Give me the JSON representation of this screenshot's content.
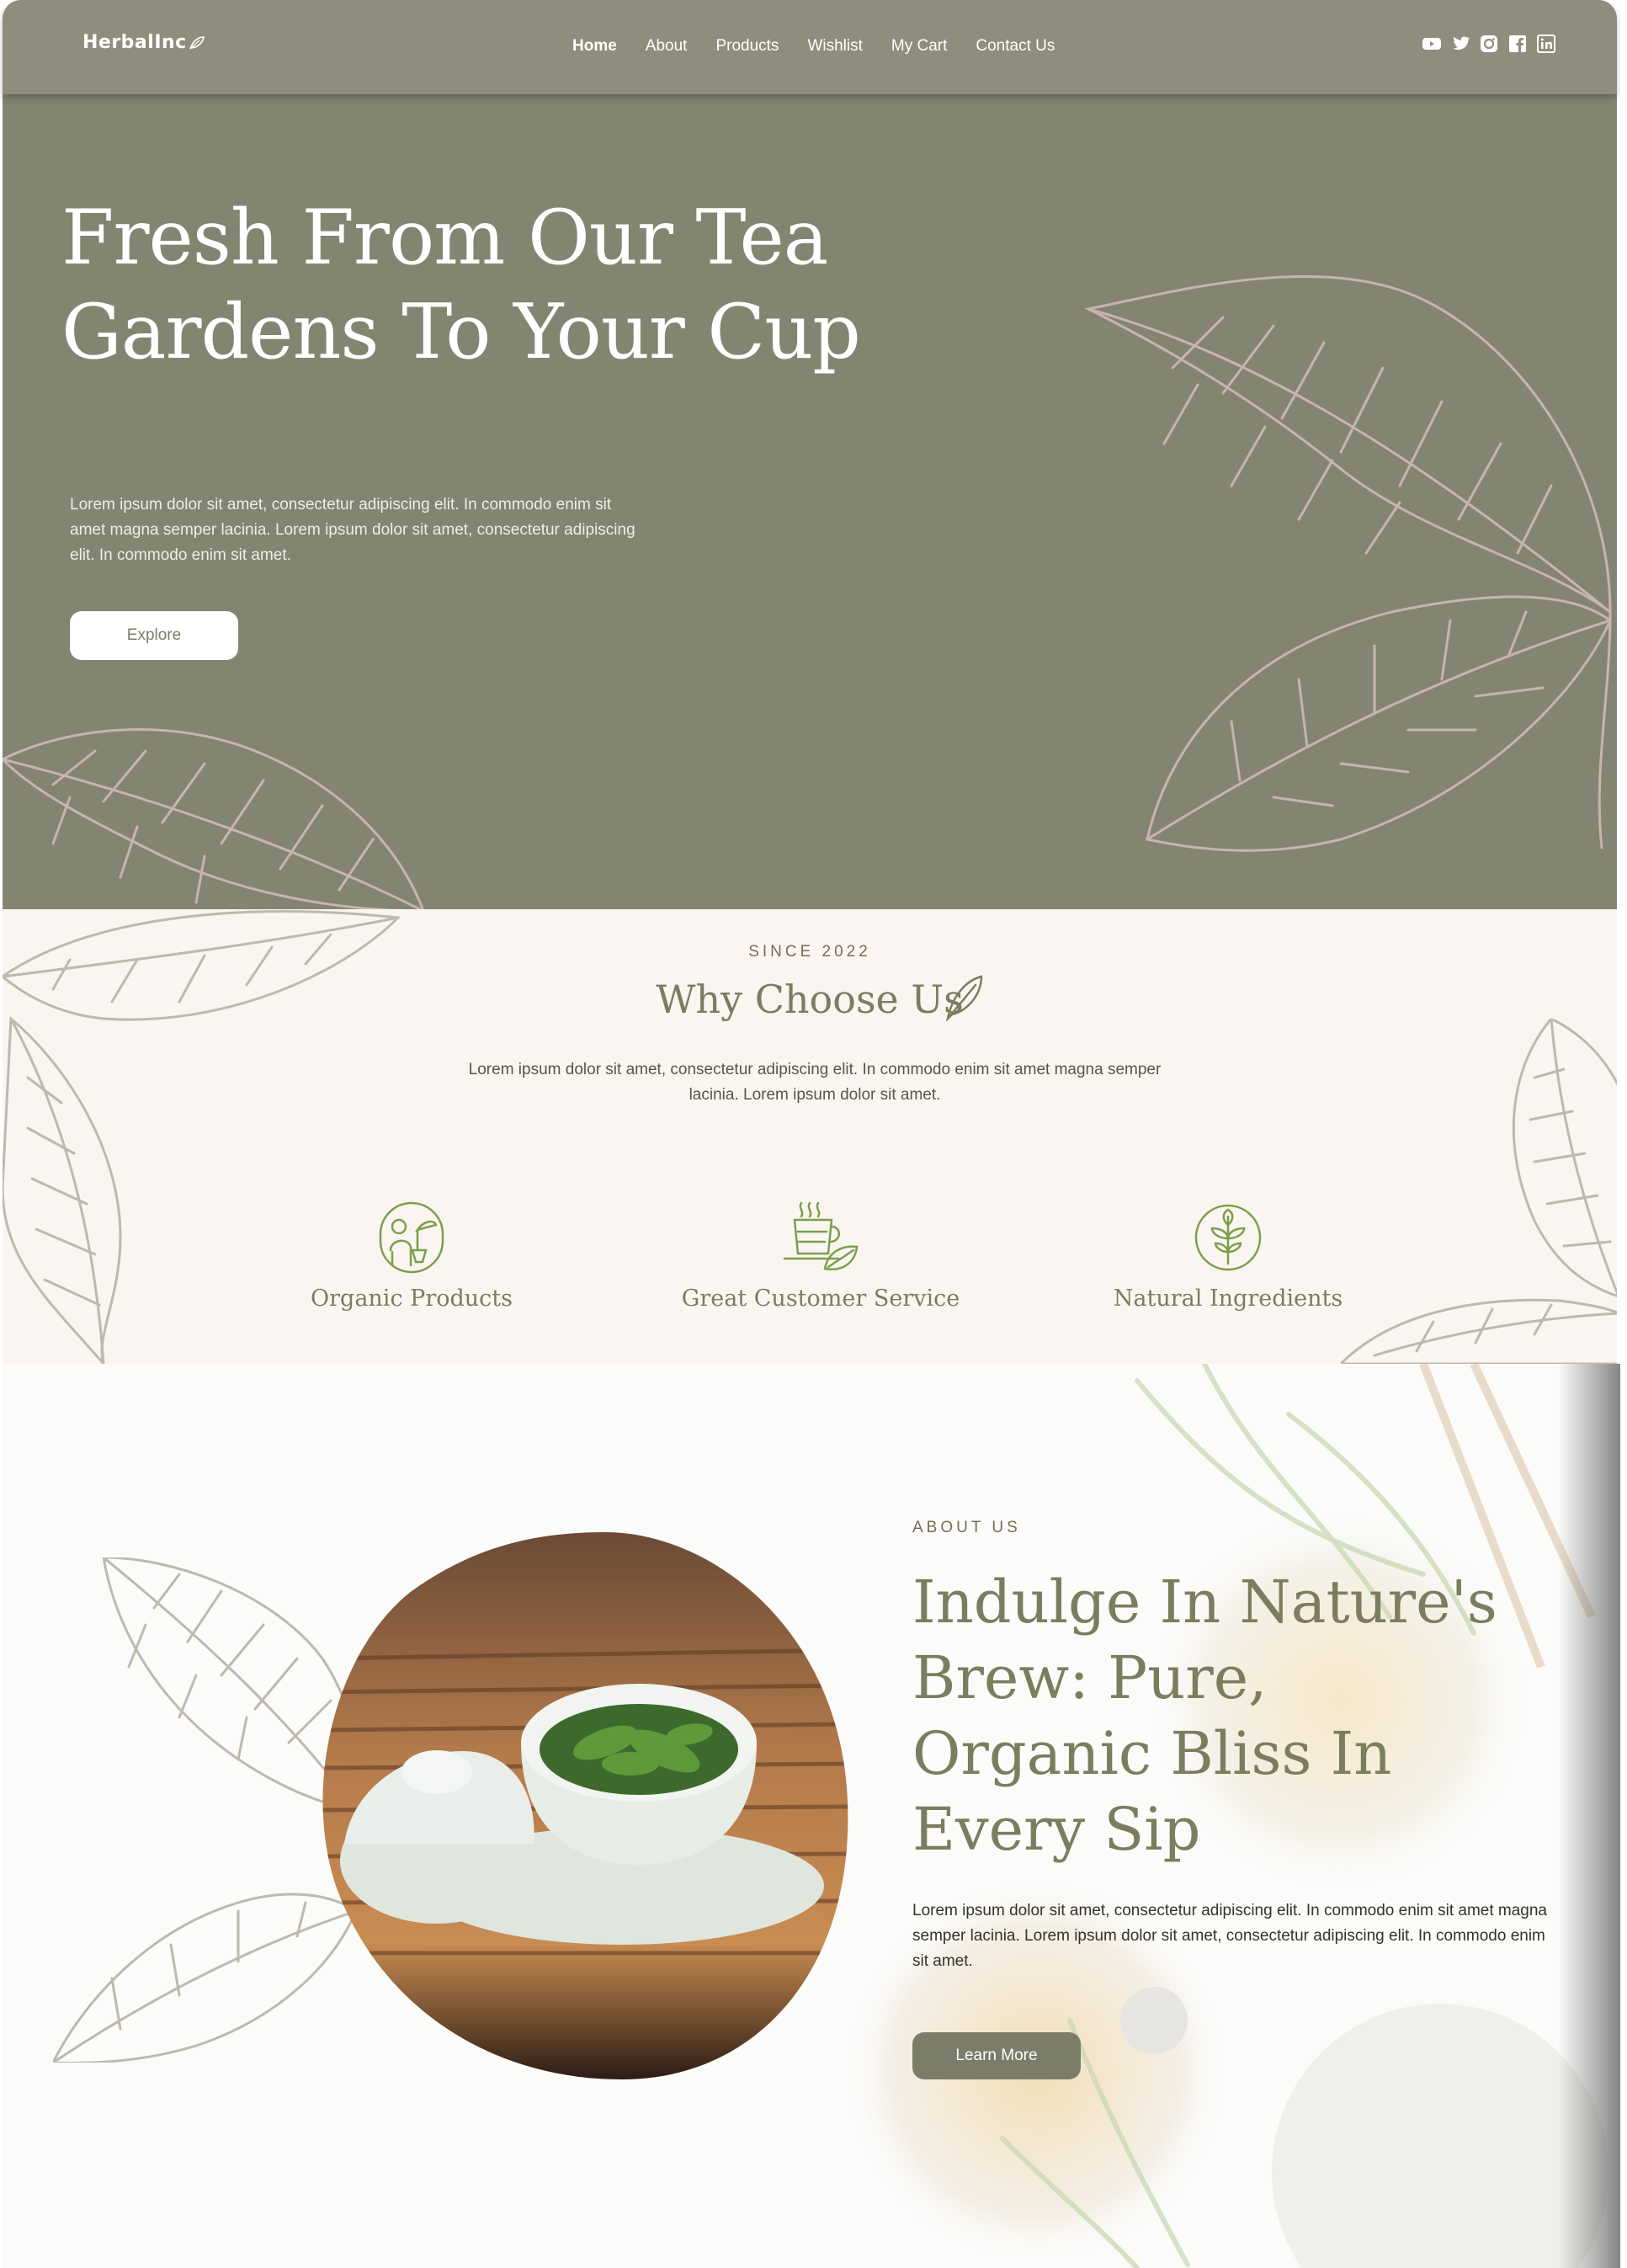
{
  "brand": {
    "name": "HerbalInc"
  },
  "nav": {
    "items": [
      {
        "label": "Home",
        "active": true
      },
      {
        "label": "About"
      },
      {
        "label": "Products"
      },
      {
        "label": "Wishlist"
      },
      {
        "label": "My Cart"
      },
      {
        "label": "Contact Us"
      }
    ],
    "socials": [
      "youtube-icon",
      "twitter-icon",
      "instagram-icon",
      "facebook-icon",
      "linkedin-icon"
    ]
  },
  "hero": {
    "title": "Fresh From Our Tea Gardens To Your Cup",
    "text": "Lorem ipsum dolor sit amet, consectetur adipiscing elit. In commodo enim sit amet magna semper lacinia. Lorem ipsum dolor sit amet, consectetur adipiscing elit. In commodo enim sit amet.",
    "button": "Explore"
  },
  "why": {
    "eyebrow": "SINCE 2022",
    "title": "Why Choose Us",
    "text": "Lorem ipsum dolor sit amet, consectetur adipiscing elit. In commodo enim sit amet magna semper lacinia. Lorem ipsum dolor sit amet.",
    "features": [
      {
        "label": "Organic Products",
        "icon": "farmer-icon"
      },
      {
        "label": "Great Customer Service",
        "icon": "tea-service-icon"
      },
      {
        "label": "Natural Ingredients",
        "icon": "plant-icon"
      }
    ]
  },
  "about": {
    "eyebrow": "ABOUT US",
    "title": "Indulge In Nature's Brew: Pure, Organic Bliss In Every Sip",
    "text": "Lorem ipsum dolor sit amet, consectetur adipiscing elit. In commodo enim sit amet magna semper lacinia. Lorem ipsum dolor sit amet, consectetur adipiscing elit. In commodo enim sit amet.",
    "button": "Learn More"
  },
  "colors": {
    "nav": "#8f8e7c",
    "hero": "#838571",
    "cream": "#fbf5f1",
    "olive_text": "#7b7d5e",
    "button_dark": "#7b7d68"
  }
}
